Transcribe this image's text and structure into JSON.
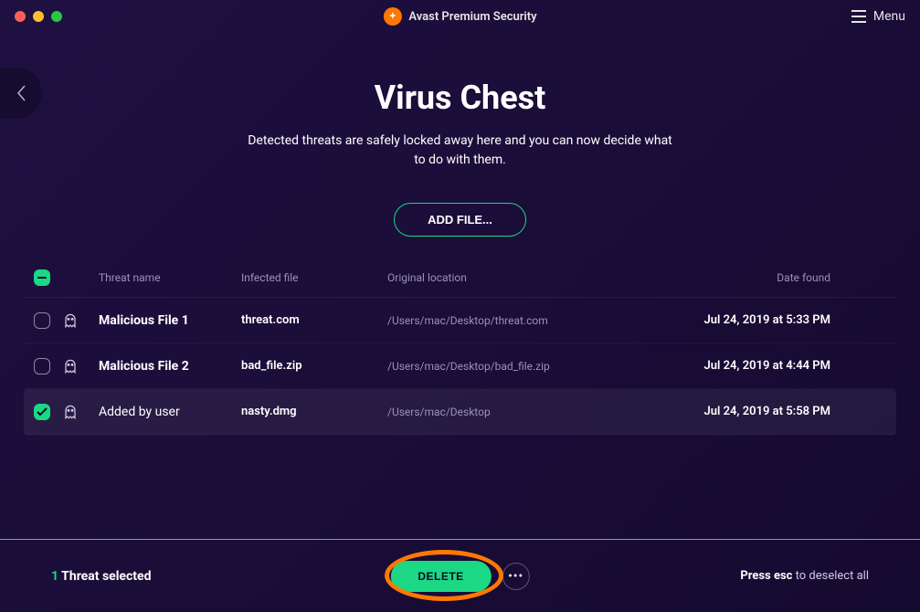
{
  "app": {
    "title": "Avast Premium Security",
    "menu_label": "Menu"
  },
  "page": {
    "title": "Virus Chest",
    "subtitle": "Detected threats are safely locked away here and you can now decide what to do with them.",
    "add_file_label": "ADD FILE..."
  },
  "table": {
    "headers": {
      "threat_name": "Threat name",
      "infected_file": "Infected file",
      "original_location": "Original location",
      "date_found": "Date found"
    },
    "rows": [
      {
        "name": "Malicious File 1",
        "file": "threat.com",
        "location": "/Users/mac/Desktop/threat.com",
        "date": "Jul 24, 2019 at 5:33 PM",
        "selected": false,
        "user_added": false
      },
      {
        "name": "Malicious File 2",
        "file": "bad_file.zip",
        "location": "/Users/mac/Desktop/bad_file.zip",
        "date": "Jul 24, 2019 at 4:44 PM",
        "selected": false,
        "user_added": false
      },
      {
        "name": "Added by user",
        "file": "nasty.dmg",
        "location": "/Users/mac/Desktop",
        "date": "Jul 24, 2019 at 5:58 PM",
        "selected": true,
        "user_added": true
      }
    ]
  },
  "footer": {
    "selected_count": "1",
    "selected_label": "Threat selected",
    "delete_label": "DELETE",
    "deselect_prefix": "Press esc",
    "deselect_suffix": " to deselect all"
  }
}
